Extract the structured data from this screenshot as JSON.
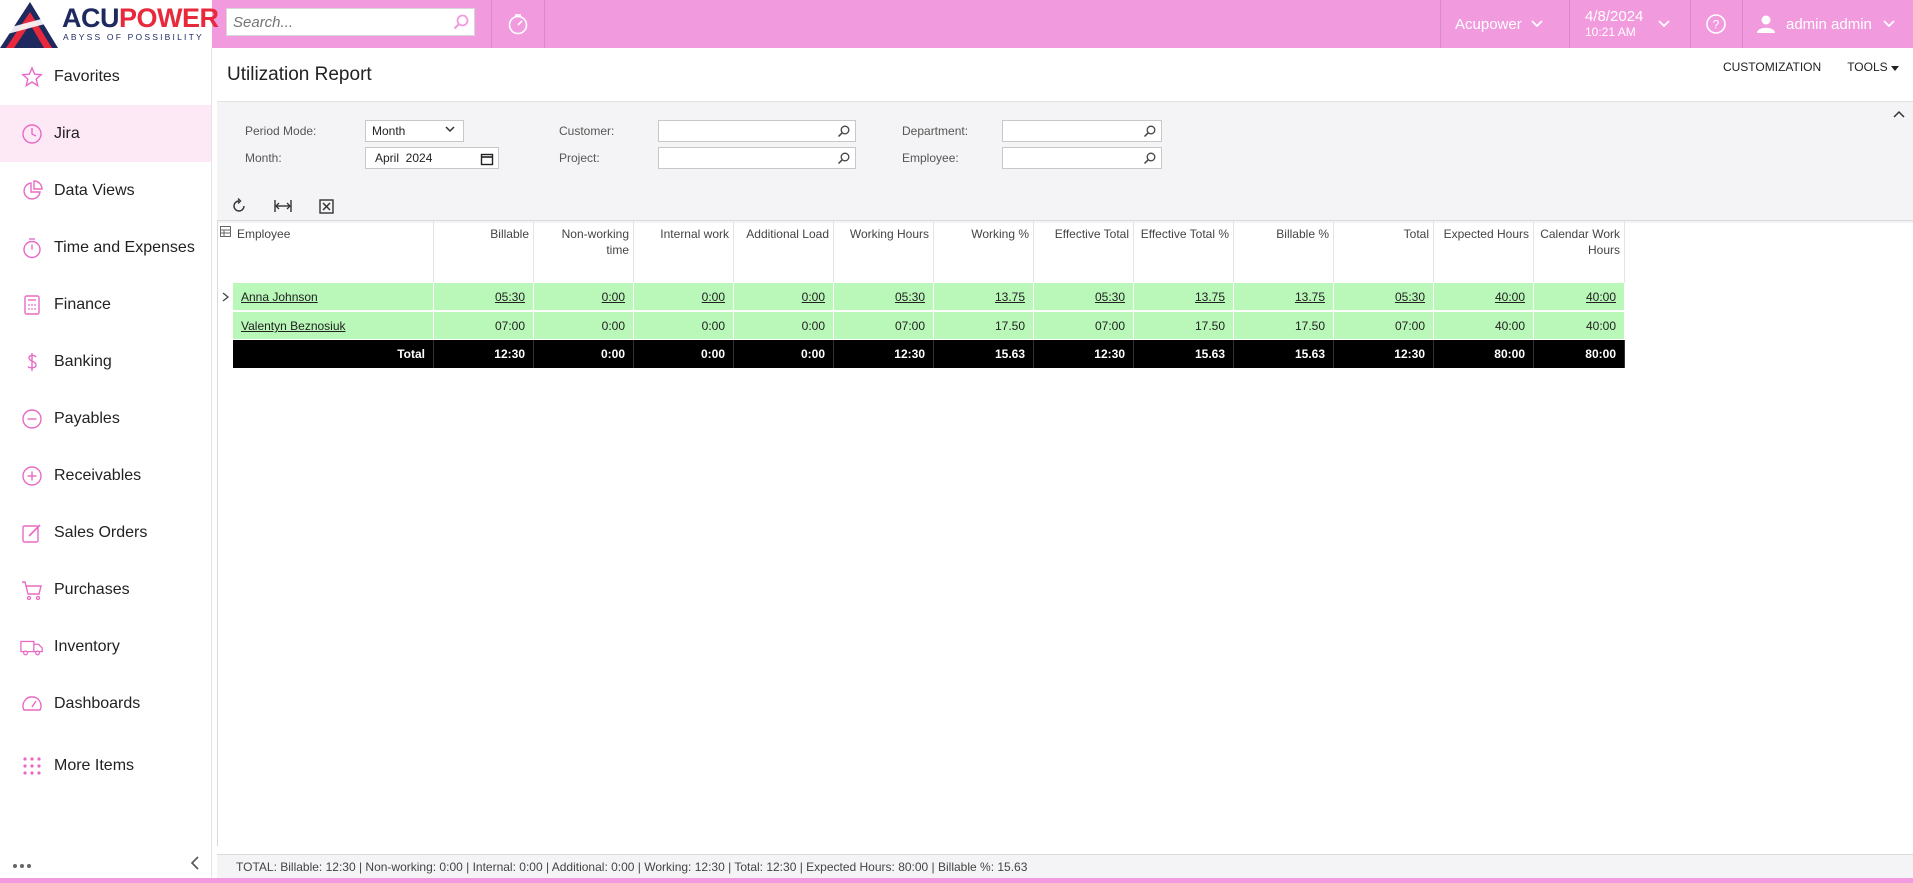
{
  "brand": {
    "name_part1": "ACU",
    "name_part2": "POWER",
    "tagline": "ABYSS OF POSSIBILITY"
  },
  "search": {
    "placeholder": "Search..."
  },
  "header": {
    "company": "Acupower",
    "date": "4/8/2024",
    "time": "10:21 AM",
    "user": "admin admin"
  },
  "sidebar": {
    "items": [
      {
        "label": "Favorites",
        "icon": "star-icon"
      },
      {
        "label": "Jira",
        "icon": "clock-icon"
      },
      {
        "label": "Data Views",
        "icon": "pie-chart-icon"
      },
      {
        "label": "Time and Expenses",
        "icon": "stopwatch-icon"
      },
      {
        "label": "Finance",
        "icon": "calculator-icon"
      },
      {
        "label": "Banking",
        "icon": "dollar-icon"
      },
      {
        "label": "Payables",
        "icon": "minus-circle-icon"
      },
      {
        "label": "Receivables",
        "icon": "plus-circle-icon"
      },
      {
        "label": "Sales Orders",
        "icon": "pencil-icon"
      },
      {
        "label": "Purchases",
        "icon": "cart-icon"
      },
      {
        "label": "Inventory",
        "icon": "truck-icon"
      },
      {
        "label": "Dashboards",
        "icon": "gauge-icon"
      },
      {
        "label": "More Items",
        "icon": "grid-dots-icon"
      }
    ]
  },
  "page": {
    "title": "Utilization Report",
    "actions": {
      "customization": "CUSTOMIZATION",
      "tools": "TOOLS"
    }
  },
  "filters": {
    "period_mode_label": "Period Mode:",
    "period_mode_value": "Month",
    "month_label": "Month:",
    "month_value": "April  2024",
    "customer_label": "Customer:",
    "customer_value": "",
    "project_label": "Project:",
    "project_value": "",
    "department_label": "Department:",
    "department_value": "",
    "employee_label": "Employee:",
    "employee_value": ""
  },
  "grid": {
    "columns": [
      {
        "label": "Employee"
      },
      {
        "label": "Billable"
      },
      {
        "label": "Non-working time"
      },
      {
        "label": "Internal work"
      },
      {
        "label": "Additional Load"
      },
      {
        "label": "Working Hours"
      },
      {
        "label": "Working %"
      },
      {
        "label": "Effective Total"
      },
      {
        "label": "Effective Total %"
      },
      {
        "label": "Billable %"
      },
      {
        "label": "Total"
      },
      {
        "label": "Expected Hours"
      },
      {
        "label": "Calendar Work Hours"
      }
    ],
    "rows": [
      [
        "Anna Johnson",
        "05:30",
        "0:00",
        "0:00",
        "0:00",
        "05:30",
        "13.75",
        "05:30",
        "13.75",
        "13.75",
        "05:30",
        "40:00",
        "40:00"
      ],
      [
        "Valentyn Beznosiuk",
        "07:00",
        "0:00",
        "0:00",
        "0:00",
        "07:00",
        "17.50",
        "07:00",
        "17.50",
        "17.50",
        "07:00",
        "40:00",
        "40:00"
      ],
      [
        "Total",
        "12:30",
        "0:00",
        "0:00",
        "0:00",
        "12:30",
        "15.63",
        "12:30",
        "15.63",
        "15.63",
        "12:30",
        "80:00",
        "80:00"
      ]
    ]
  },
  "footer": {
    "summary": "TOTAL: Billable: 12:30 | Non-working: 0:00 | Internal: 0:00 | Additional: 0:00 | Working: 12:30 | Total: 12:30 | Expected Hours: 80:00 | Billable %: 15.63"
  },
  "colors": {
    "topbar": "#f29ade",
    "accent": "#e86ac6",
    "row_green": "#b9f8b9",
    "total_row": "#000000",
    "active_nav": "#fde8f6"
  }
}
